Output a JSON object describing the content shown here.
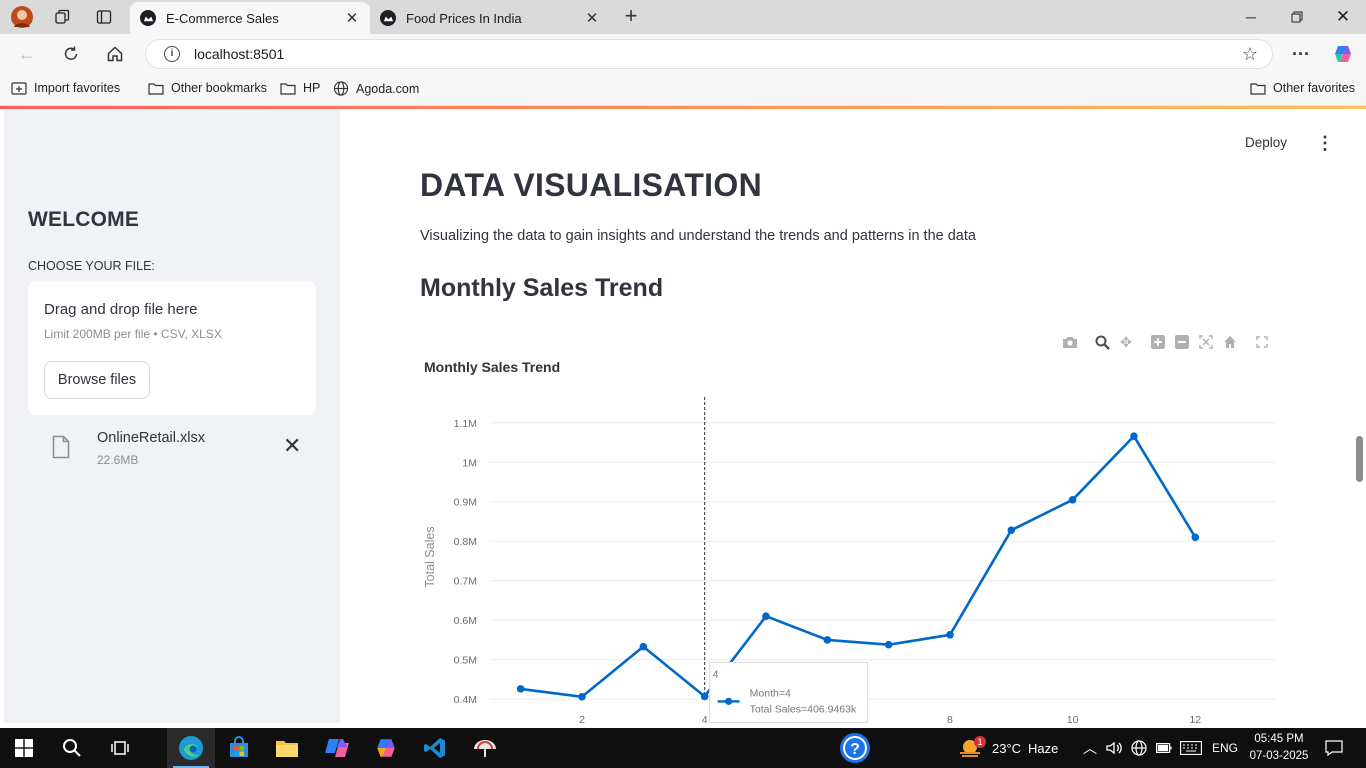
{
  "browser": {
    "tabs": [
      {
        "title": "E-Commerce Sales",
        "active": true
      },
      {
        "title": "Food Prices In India",
        "active": false
      }
    ],
    "url": "localhost:8501",
    "bookmarks": [
      "Import favorites",
      "Other bookmarks",
      "HP",
      "Agoda.com"
    ],
    "other_favorites": "Other favorites"
  },
  "sidebar": {
    "welcome": "WELCOME",
    "choose_label": "CHOOSE YOUR FILE:",
    "dropzone": {
      "title": "Drag and drop file here",
      "limit": "Limit 200MB per file • CSV, XLSX",
      "browse_label": "Browse files"
    },
    "file": {
      "name": "OnlineRetail.xlsx",
      "size": "22.6MB"
    }
  },
  "header": {
    "deploy_label": "Deploy"
  },
  "main": {
    "title": "DATA VISUALISATION",
    "lead": "Visualizing the data to gain insights and understand the trends and patterns in the data",
    "section_title": "Monthly Sales Trend"
  },
  "chart_data": {
    "type": "line",
    "title": "Monthly Sales Trend",
    "xlabel": "",
    "ylabel": "Total Sales",
    "x": [
      1,
      2,
      3,
      4,
      5,
      6,
      7,
      8,
      9,
      10,
      11,
      12
    ],
    "y": [
      426000,
      406000,
      533000,
      406946.3,
      610000,
      550000,
      538000,
      563000,
      828000,
      905000,
      1066000,
      810000
    ],
    "x_ticks": [
      "2",
      "4",
      "6",
      "8",
      "10",
      "12"
    ],
    "x_tick_values": [
      2,
      4,
      6,
      8,
      10,
      12
    ],
    "y_ticks": [
      "0.4M",
      "0.5M",
      "0.6M",
      "0.7M",
      "0.8M",
      "0.9M",
      "1M",
      "1.1M"
    ],
    "y_tick_values": [
      400000,
      500000,
      600000,
      700000,
      800000,
      900000,
      1000000,
      1100000
    ],
    "xlim": [
      0.5,
      13.3
    ],
    "ylim": [
      375000,
      1140000
    ],
    "line_color": "#0068c9",
    "grid": true,
    "hover": {
      "x": 4,
      "header": "4",
      "line1": "Month=4",
      "line2": "Total Sales=406.9463k"
    }
  },
  "taskbar": {
    "weather": {
      "temp": "23°C",
      "cond": "Haze",
      "badge": "1"
    },
    "lang": "ENG",
    "time": "05:45 PM",
    "date": "07-03-2025"
  }
}
